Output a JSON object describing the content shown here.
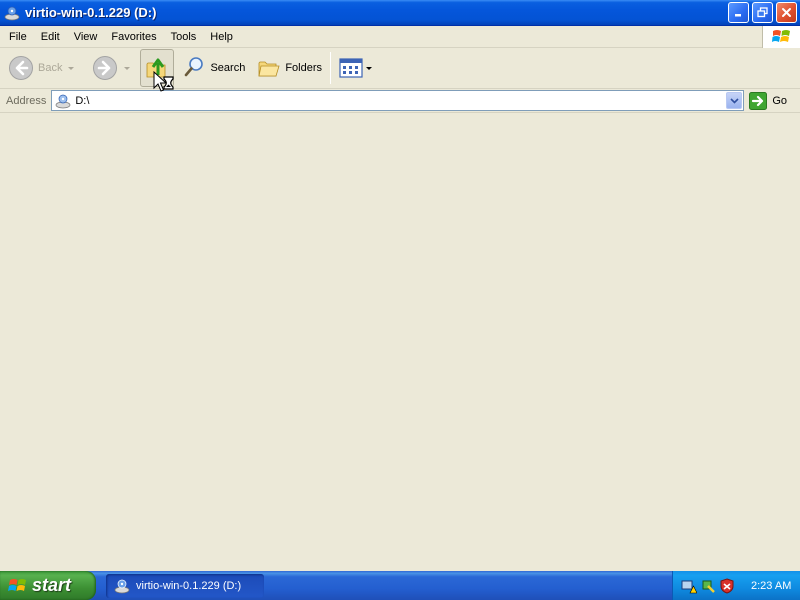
{
  "window": {
    "title": "virtio-win-0.1.229 (D:)",
    "controls": [
      "minimize-icon",
      "restore-icon",
      "close-icon"
    ]
  },
  "menu": {
    "items": [
      "File",
      "Edit",
      "View",
      "Favorites",
      "Tools",
      "Help"
    ]
  },
  "toolbar": {
    "back_label": "Back",
    "search_label": "Search",
    "folders_label": "Folders"
  },
  "address": {
    "label": "Address",
    "value": "D:\\",
    "go_label": "Go"
  },
  "taskbar": {
    "start_label": "start",
    "task_title": "virtio-win-0.1.229 (D:)",
    "clock": "2:23 AM"
  },
  "colors": {
    "titlebar_blue": "#0556db",
    "window_bg": "#ece9d8",
    "start_green": "#3c8f33",
    "tray_blue": "#0f8ae0"
  }
}
